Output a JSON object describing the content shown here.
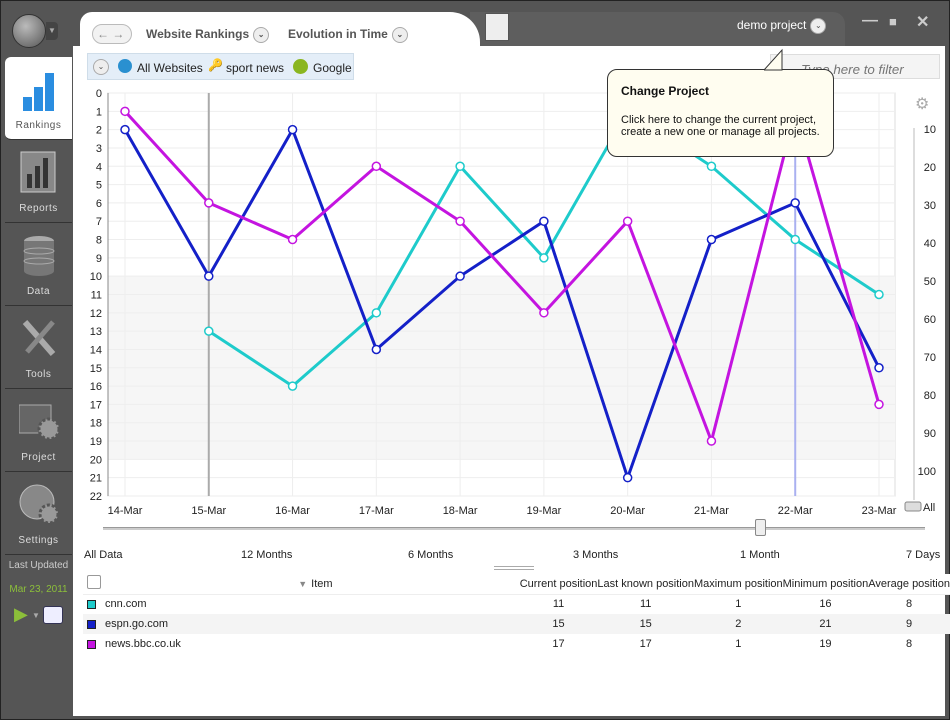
{
  "window": {
    "project": "demo project",
    "minimize": "—",
    "maximize": "■",
    "close": "✕"
  },
  "nav": {
    "back": "←",
    "forward": "→",
    "breadcrumb": [
      "Website Rankings",
      "Evolution in Time"
    ]
  },
  "filters": {
    "websites": "All Websites",
    "keyword": "sport news",
    "engine": "Google"
  },
  "search": {
    "placeholder": "Type here to filter"
  },
  "tooltip": {
    "title": "Change Project",
    "body": "Click here to change the current project, create a new one or manage all projects."
  },
  "sidebar": {
    "items": [
      {
        "label": "Rankings",
        "icon": "bar-chart-icon"
      },
      {
        "label": "Reports",
        "icon": "report-icon"
      },
      {
        "label": "Data",
        "icon": "database-icon"
      },
      {
        "label": "Tools",
        "icon": "tools-icon"
      },
      {
        "label": "Project",
        "icon": "project-gear-icon"
      },
      {
        "label": "Settings",
        "icon": "globe-gear-icon"
      }
    ],
    "last_updated_label": "Last Updated",
    "last_updated": "Mar 23, 2011"
  },
  "chart_data": {
    "type": "line",
    "categories": [
      "14-Mar",
      "15-Mar",
      "16-Mar",
      "17-Mar",
      "18-Mar",
      "19-Mar",
      "20-Mar",
      "21-Mar",
      "22-Mar",
      "23-Mar"
    ],
    "ylim": [
      0,
      22
    ],
    "y_inverted": true,
    "y_ticks": [
      0,
      1,
      2,
      3,
      4,
      5,
      6,
      7,
      8,
      9,
      10,
      11,
      12,
      13,
      14,
      15,
      16,
      17,
      18,
      19,
      20,
      21,
      22
    ],
    "y2_ticks": [
      10,
      20,
      30,
      40,
      50,
      60,
      70,
      80,
      90,
      100
    ],
    "y2_button": "All",
    "grid": true,
    "series": [
      {
        "name": "cnn.com",
        "color": "#1ecbcb",
        "values": [
          null,
          13,
          16,
          12,
          4,
          9,
          1,
          4,
          8,
          11
        ]
      },
      {
        "name": "espn.go.com",
        "color": "#1420c8",
        "values": [
          2,
          10,
          2,
          14,
          10,
          7,
          21,
          8,
          6,
          15
        ]
      },
      {
        "name": "news.bbc.co.uk",
        "color": "#c414e0",
        "values": [
          1,
          6,
          8,
          4,
          7,
          12,
          7,
          19,
          1,
          17
        ]
      }
    ]
  },
  "range": {
    "labels": [
      "All Data",
      "12 Months",
      "6 Months",
      "3 Months",
      "1 Month",
      "7 Days"
    ],
    "selected": "1 Month"
  },
  "table": {
    "columns": [
      "Item",
      "Current position",
      "Last known position",
      "Maximum position",
      "Minimum position",
      "Average position"
    ],
    "rows": [
      {
        "item": "cnn.com",
        "color": "#1ecbcb",
        "values": [
          "11",
          "11",
          "1",
          "16",
          "8"
        ]
      },
      {
        "item": "espn.go.com",
        "color": "#1420c8",
        "values": [
          "15",
          "15",
          "2",
          "21",
          "9"
        ]
      },
      {
        "item": "news.bbc.co.uk",
        "color": "#c414e0",
        "values": [
          "17",
          "17",
          "1",
          "19",
          "8"
        ]
      }
    ]
  }
}
